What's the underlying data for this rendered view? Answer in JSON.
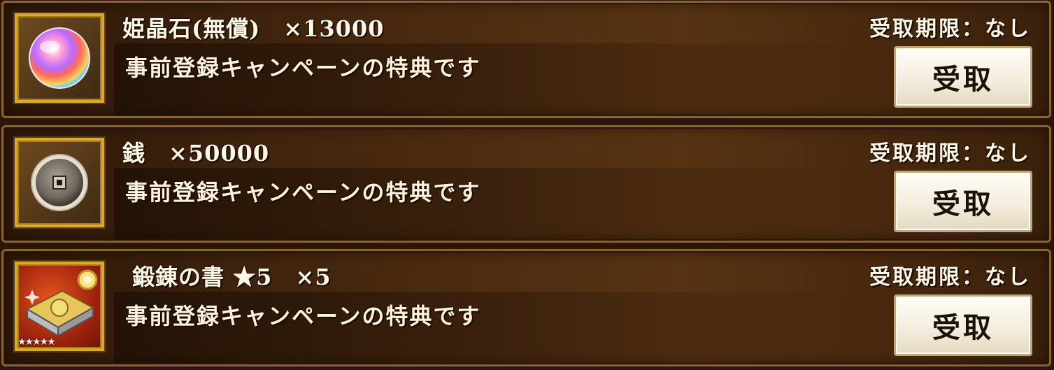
{
  "rewards": [
    {
      "name": "姫晶石(無償)　×13000",
      "description": "事前登録キャンペーンの特典です",
      "deadline": "受取期限：なし",
      "button_label": "受取",
      "icon": "rainbow-orb-icon"
    },
    {
      "name": "銭　×50000",
      "description": "事前登録キャンペーンの特典です",
      "deadline": "受取期限：なし",
      "button_label": "受取",
      "icon": "coin-icon"
    },
    {
      "name": "鍛錬の書 ★5　×5",
      "description": "事前登録キャンペーンの特典です",
      "deadline": "受取期限：なし",
      "button_label": "受取",
      "icon": "training-book-icon",
      "stars": "★★★★★"
    }
  ],
  "colors": {
    "frame_gold": "#d9a929",
    "panel_brown": "#4a2a10",
    "button_bg": "#f3ecdc"
  }
}
